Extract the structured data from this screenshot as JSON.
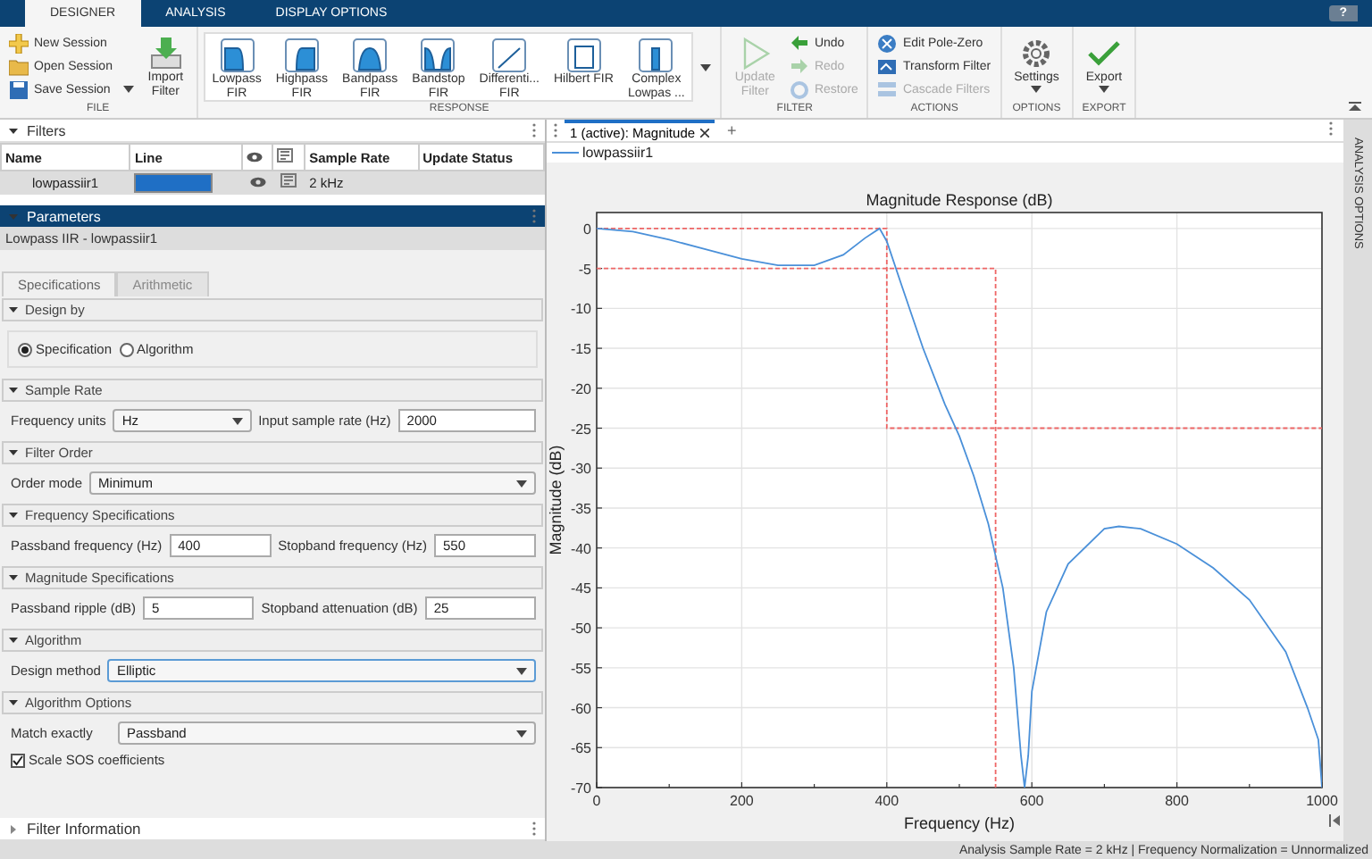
{
  "app_tabs": [
    {
      "label": "DESIGNER",
      "selected": true
    },
    {
      "label": "ANALYSIS",
      "selected": false
    },
    {
      "label": "DISPLAY OPTIONS",
      "selected": false
    }
  ],
  "help": "?",
  "ribbon": [
    {
      "label": "FILE",
      "small": [
        {
          "label": "New Session",
          "disabled": false
        },
        {
          "label": "Open Session",
          "disabled": false
        },
        {
          "label": "Save Session",
          "disabled": false,
          "menu": true
        }
      ],
      "large": [
        {
          "lines": [
            "Import",
            "Filter"
          ],
          "disabled": false
        }
      ]
    },
    {
      "label": "RESPONSE",
      "gallery": true,
      "large": [
        {
          "lines": [
            "Lowpass",
            "FIR"
          ],
          "disabled": false
        },
        {
          "lines": [
            "Highpass",
            "FIR"
          ],
          "disabled": false
        },
        {
          "lines": [
            "Bandpass",
            "FIR"
          ],
          "disabled": false
        },
        {
          "lines": [
            "Bandstop",
            "FIR"
          ],
          "disabled": false
        },
        {
          "lines": [
            "Differenti...",
            "FIR"
          ],
          "disabled": false
        },
        {
          "lines": [
            "Hilbert FIR"
          ],
          "disabled": false
        },
        {
          "lines": [
            "Complex",
            "Lowpas ..."
          ],
          "disabled": false
        }
      ]
    },
    {
      "label": "FILTER",
      "large": [
        {
          "lines": [
            "Update",
            "Filter"
          ],
          "disabled": true
        }
      ],
      "small": [
        {
          "label": "Undo",
          "disabled": false
        },
        {
          "label": "Redo",
          "disabled": true
        },
        {
          "label": "Restore",
          "disabled": true
        }
      ]
    },
    {
      "label": "ACTIONS",
      "small": [
        {
          "label": "Edit Pole-Zero",
          "disabled": false
        },
        {
          "label": "Transform Filter",
          "disabled": false
        },
        {
          "label": "Cascade Filters",
          "disabled": true
        }
      ]
    },
    {
      "label": "OPTIONS",
      "large": [
        {
          "lines": [
            "Settings"
          ],
          "disabled": false,
          "menu": true
        }
      ]
    },
    {
      "label": "EXPORT",
      "large": [
        {
          "lines": [
            "Export"
          ],
          "disabled": false,
          "menu": true
        }
      ]
    }
  ],
  "filters": {
    "title": "Filters",
    "expanded": true,
    "columns": [
      {
        "kind": "text",
        "label": "Name"
      },
      {
        "kind": "text",
        "label": "Line"
      },
      {
        "kind": "eye"
      },
      {
        "kind": "export"
      },
      {
        "kind": "text",
        "label": "Sample Rate"
      },
      {
        "kind": "text",
        "label": "Update Status"
      }
    ],
    "rows": [
      {
        "name": "lowpassiir1",
        "color": "#1f6fc5",
        "visible": true,
        "sample_rate": "2 kHz",
        "selected": true
      }
    ]
  },
  "parameters": {
    "title": "Parameters",
    "expanded": true,
    "subtitle": "Lowpass IIR - lowpassiir1",
    "tabs": [
      {
        "label": "Specifications",
        "selected": true
      },
      {
        "label": "Arithmetic",
        "selected": false
      }
    ],
    "sections": [
      {
        "title": "Design by",
        "expanded": true,
        "boxed": true,
        "rows": [
          [
            {
              "kind": "radio",
              "label": "Specification",
              "selected": true
            },
            {
              "kind": "radio",
              "label": "Algorithm",
              "selected": false
            }
          ]
        ]
      },
      {
        "title": "Sample Rate",
        "expanded": true,
        "rows": [
          [
            {
              "kind": "dropdown",
              "label": "Frequency units",
              "value": "Hz"
            },
            {
              "kind": "text",
              "label": "Input sample rate (Hz)",
              "value": "2000"
            }
          ]
        ]
      },
      {
        "title": "Filter Order",
        "expanded": true,
        "rows": [
          [
            {
              "kind": "dropdown",
              "label": "Order mode",
              "value": "Minimum"
            }
          ]
        ]
      },
      {
        "title": "Frequency Specifications",
        "expanded": true,
        "rows": [
          [
            {
              "kind": "text",
              "label": "Passband frequency (Hz)",
              "value": "400"
            },
            {
              "kind": "text",
              "label": "Stopband frequency (Hz)",
              "value": "550"
            }
          ]
        ]
      },
      {
        "title": "Magnitude Specifications",
        "expanded": true,
        "rows": [
          [
            {
              "kind": "text",
              "label": "Passband ripple (dB)",
              "value": "5"
            },
            {
              "kind": "text",
              "label": "Stopband attenuation (dB)",
              "value": "25"
            }
          ]
        ]
      },
      {
        "title": "Algorithm",
        "expanded": true,
        "rows": [
          [
            {
              "kind": "dropdown",
              "label": "Design method",
              "value": "Elliptic",
              "focused": true
            }
          ]
        ]
      },
      {
        "title": "Algorithm Options",
        "expanded": true,
        "rows": [
          [
            {
              "kind": "dropdown",
              "label": "Match exactly",
              "value": "Passband",
              "wide_label": true
            }
          ],
          [
            {
              "kind": "checkbox",
              "label": "Scale SOS coefficients",
              "checked": true
            }
          ]
        ]
      }
    ]
  },
  "filter_information": {
    "title": "Filter Information",
    "expanded": false
  },
  "document_tabs": [
    {
      "label": "1 (active): Magnitude",
      "selected": true,
      "closable": true
    }
  ],
  "add_tab": "+",
  "chart_data": {
    "type": "line",
    "title": "Magnitude Response (dB)",
    "xlabel": "Frequency (Hz)",
    "ylabel": "Magnitude (dB)",
    "x": [
      0,
      50,
      100,
      150,
      200,
      250,
      300,
      340,
      370,
      390,
      400,
      400,
      420,
      450,
      480,
      500,
      520,
      540,
      550,
      550,
      560,
      575,
      585,
      590,
      595,
      600,
      620,
      650,
      700,
      720,
      750,
      800,
      850,
      900,
      950,
      980,
      995,
      1000
    ],
    "series": [
      {
        "name": "lowpassiir1",
        "color": "#4a90d9",
        "values": [
          0,
          -0.4,
          -1.4,
          -2.6,
          -3.8,
          -4.6,
          -4.6,
          -3.3,
          -1.2,
          0,
          -1.6,
          -1.6,
          -7,
          -15,
          -22,
          -26,
          -31,
          -37,
          -41,
          -41,
          -45,
          -55,
          -66,
          -70,
          -66,
          -58,
          -48,
          -42,
          -37.6,
          -37.3,
          -37.6,
          -39.5,
          -42.5,
          -46.5,
          -53,
          -60,
          -64,
          -70
        ]
      },
      {
        "color": "#ee6666",
        "line_style": "dashed",
        "values": [
          0,
          0,
          0,
          0,
          0,
          0,
          0,
          0,
          0,
          0,
          0,
          -25,
          -25,
          -25,
          -25,
          -25,
          -25,
          -25,
          -25,
          -25,
          -25,
          -25,
          -25,
          -25,
          -25,
          -25,
          -25,
          -25,
          -25,
          -25,
          -25,
          -25,
          -25,
          -25,
          -25,
          -25,
          -25,
          -25
        ]
      },
      {
        "color": "#ee6666",
        "line_style": "dashed",
        "values": [
          -5,
          -5,
          -5,
          -5,
          -5,
          -5,
          -5,
          -5,
          -5,
          -5,
          -5,
          -5,
          -5,
          -5,
          -5,
          -5,
          -5,
          -5,
          -5,
          -70,
          null,
          null,
          null,
          null,
          null,
          null,
          null,
          null,
          null,
          null,
          null,
          null,
          null,
          null,
          null,
          null,
          null,
          null
        ]
      }
    ],
    "xlim": [
      0,
      1000
    ],
    "ylim": [
      -70,
      2
    ],
    "grid": true,
    "xticks": [
      0,
      200,
      400,
      600,
      800,
      1000
    ],
    "yticks": [
      0,
      -5,
      -10,
      -15,
      -20,
      -25,
      -30,
      -35,
      -40,
      -45,
      -50,
      -55,
      -60,
      -65,
      -70
    ]
  },
  "side_tab": "ANALYSIS OPTIONS",
  "status_bar": "Analysis Sample Rate = 2 kHz | Frequency Normalization = Unnormalized"
}
